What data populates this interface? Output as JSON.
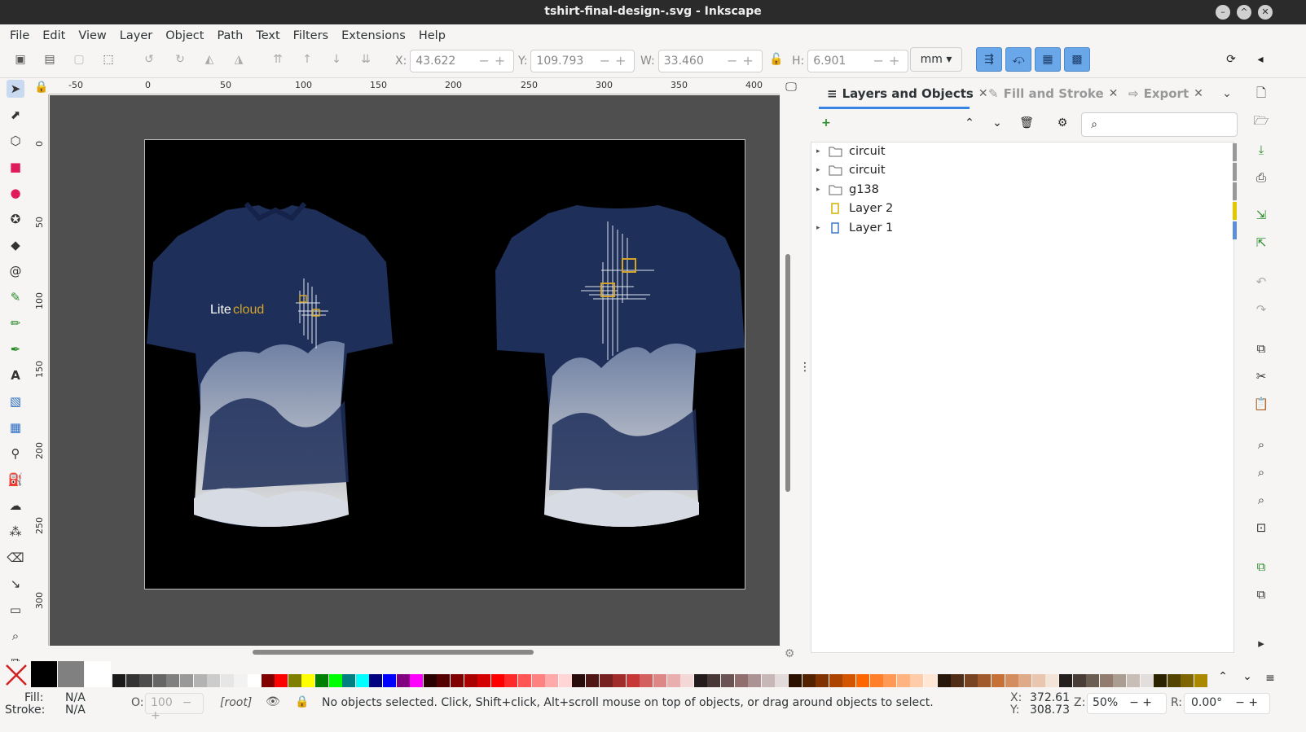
{
  "window": {
    "title": "tshirt-final-design-.svg - Inkscape"
  },
  "menu": [
    "File",
    "Edit",
    "View",
    "Layer",
    "Object",
    "Path",
    "Text",
    "Filters",
    "Extensions",
    "Help"
  ],
  "transform": {
    "x_label": "X:",
    "x_value": "43.622",
    "y_label": "Y:",
    "y_value": "109.793",
    "w_label": "W:",
    "w_value": "33.460",
    "h_label": "H:",
    "h_value": "6.901",
    "unit": "mm"
  },
  "rulers": {
    "h_ticks": [
      "-50",
      "0",
      "50",
      "100",
      "150",
      "200",
      "250",
      "300",
      "350",
      "400"
    ],
    "v_ticks": [
      "0",
      "50",
      "100",
      "150",
      "200",
      "250",
      "300"
    ]
  },
  "canvas": {
    "logo_text_a": "Lite",
    "logo_text_b": "cloud",
    "accent": "#d4a52a",
    "shirt": "#1e2f5a"
  },
  "dock": {
    "tabs": [
      {
        "label": "Layers and Objects",
        "close": "✕"
      },
      {
        "label": "Fill and Stroke",
        "close": "✕"
      },
      {
        "label": "Export",
        "close": "✕"
      }
    ],
    "tree": [
      {
        "label": "circuit",
        "type": "group",
        "expandable": true
      },
      {
        "label": "circuit",
        "type": "group",
        "expandable": true
      },
      {
        "label": "g138",
        "type": "group",
        "expandable": true
      },
      {
        "label": "Layer 2",
        "type": "layer",
        "expandable": false
      },
      {
        "label": "Layer 1",
        "type": "layer",
        "expandable": true
      }
    ]
  },
  "status": {
    "fill_label": "Fill:",
    "fill_value": "N/A",
    "stroke_label": "Stroke:",
    "stroke_value": "N/A",
    "opacity_label": "O:",
    "opacity_value": "100",
    "layer": "[root]",
    "message": "No objects selected. Click, Shift+click, Alt+scroll mouse on top of objects, or drag around objects to select.",
    "cursor_x_label": "X:",
    "cursor_x": "372.61",
    "cursor_y_label": "Y:",
    "cursor_y": "308.73",
    "zoom_label": "Z:",
    "zoom": "50%",
    "rotation_label": "R:",
    "rotation": "0.00°"
  }
}
